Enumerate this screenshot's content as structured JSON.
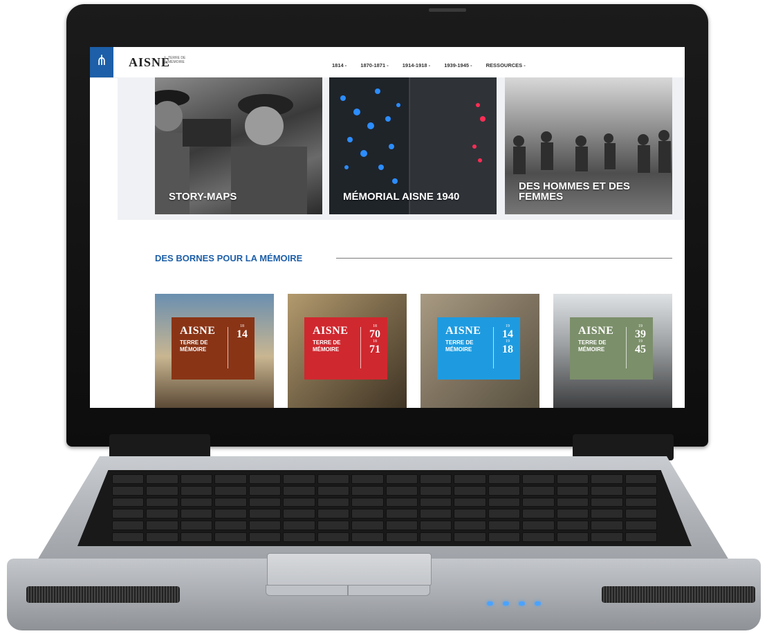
{
  "site": {
    "brand": "AISNE",
    "brand_sub": "TERRE DE MÉMOIRE",
    "nav": [
      "1814 -",
      "1870-1871 -",
      "1914-1918 -",
      "1939-1945 -",
      "RESSOURCES -"
    ]
  },
  "hero_tiles": [
    {
      "title": "STORY-MAPS"
    },
    {
      "title": "MÉMORIAL AISNE 1940"
    },
    {
      "title": "DES HOMMES ET DES FEMMES"
    }
  ],
  "section": {
    "title": "DES BORNES POUR LA MÉMOIRE"
  },
  "cards": [
    {
      "main": "AISNE",
      "sub1": "TERRE DE",
      "sub2": "MÉMOIRE",
      "y1": "18",
      "y1b": "14",
      "y2": "",
      "y2b": "",
      "color": "#8a3416"
    },
    {
      "main": "AISNE",
      "sub1": "TERRE DE",
      "sub2": "MÉMOIRE",
      "y1": "18",
      "y1b": "70",
      "y2": "18",
      "y2b": "71",
      "color": "#d0282f"
    },
    {
      "main": "AISNE",
      "sub1": "TERRE DE",
      "sub2": "MÉMOIRE",
      "y1": "19",
      "y1b": "14",
      "y2": "19",
      "y2b": "18",
      "color": "#1e9be0"
    },
    {
      "main": "AISNE",
      "sub1": "TERRE DE",
      "sub2": "MÉMOIRE",
      "y1": "19",
      "y1b": "39",
      "y2": "19",
      "y2b": "45",
      "color": "#7b8f6a"
    }
  ],
  "colors": {
    "brand_blue": "#1d5fa8"
  }
}
